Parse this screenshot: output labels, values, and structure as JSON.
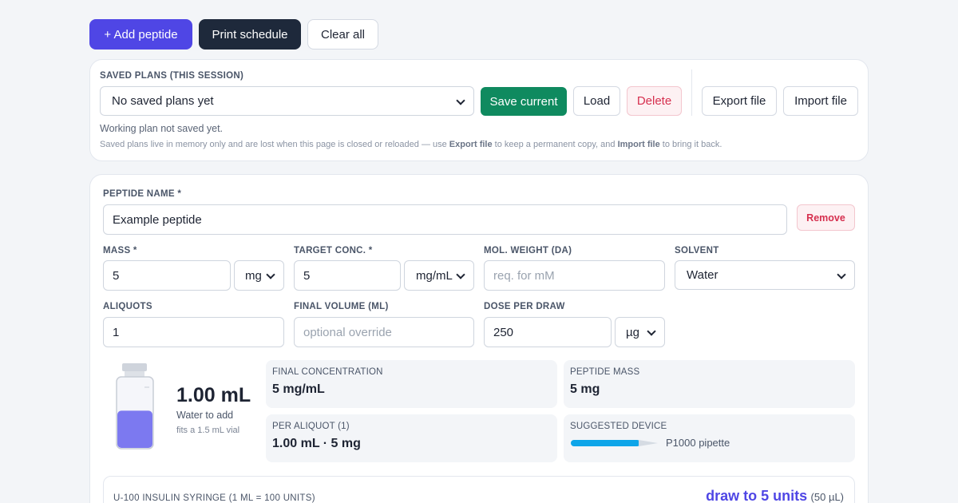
{
  "toolbar": {
    "add_label": "+ Add peptide",
    "print_label": "Print schedule",
    "clear_label": "Clear all"
  },
  "plans": {
    "section_label": "SAVED PLANS (THIS SESSION)",
    "select_value": "No saved plans yet",
    "save_label": "Save current",
    "load_label": "Load",
    "delete_label": "Delete",
    "export_label": "Export file",
    "import_label": "Import file",
    "status": "Working plan not saved yet.",
    "note_pre": "Saved plans live in memory only and are lost when this page is closed or reloaded — use ",
    "note_export": "Export file",
    "note_mid": " to keep a permanent copy, and ",
    "note_import": "Import file",
    "note_post": " to bring it back."
  },
  "peptide": {
    "name_label": "PEPTIDE NAME *",
    "name_value": "Example peptide",
    "remove_label": "Remove",
    "mass_label": "MASS *",
    "mass_value": "5",
    "mass_unit": "mg",
    "target_label": "TARGET CONC. *",
    "target_value": "5",
    "target_unit": "mg/mL",
    "molw_label": "MOL. WEIGHT (DA)",
    "molw_placeholder": "req. for mM",
    "solvent_label": "SOLVENT",
    "solvent_value": "Water",
    "aliquots_label": "ALIQUOTS",
    "aliquots_value": "1",
    "finalvol_label": "FINAL VOLUME (ML)",
    "finalvol_placeholder": "optional override",
    "dose_label": "DOSE PER DRAW",
    "dose_value": "250",
    "dose_unit": "µg"
  },
  "result": {
    "volume": "1.00 mL",
    "volume_caption": "Water to add",
    "vial_note": "fits a 1.5 mL vial",
    "vial_fill_fraction": 0.53,
    "vial_color": "#7c79f0",
    "final_conc_label": "FINAL CONCENTRATION",
    "final_conc_value": "5 mg/mL",
    "peptide_mass_label": "PEPTIDE MASS",
    "peptide_mass_value": "5 mg",
    "per_aliquot_label": "PER ALIQUOT (1)",
    "per_aliquot_value": "1.00 mL · 5 mg",
    "device_label": "SUGGESTED DEVICE",
    "device_name": "P1000 pipette",
    "device_color": "#0ea5e9"
  },
  "syringe": {
    "label": "U-100 INSULIN SYRINGE (1 ML = 100 UNITS)",
    "draw_text": "draw to 5 units",
    "draw_ul": "(50 µL)"
  },
  "colors": {
    "accent": "#4f46e5",
    "save": "#0f8a5f",
    "danger": "#d6304f",
    "dark": "#1e293b"
  }
}
